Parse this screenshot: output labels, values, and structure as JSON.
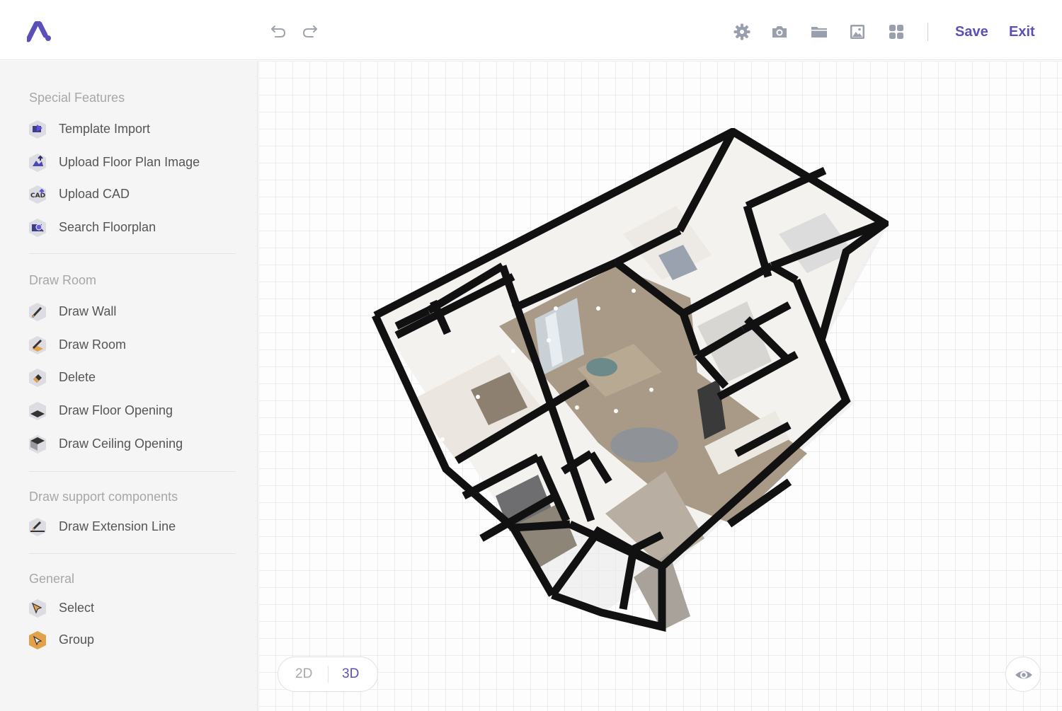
{
  "header": {
    "logo_icon": "brand-logo-icon",
    "undo_icon": "undo-icon",
    "redo_icon": "redo-icon",
    "tools": [
      "gear-icon",
      "camera-icon",
      "folder-icon",
      "image-icon",
      "grid-icon"
    ],
    "save_label": "Save",
    "exit_label": "Exit",
    "accent_color": "#5b50b8"
  },
  "sidebar": {
    "sections": [
      {
        "title": "Special Features",
        "items": [
          {
            "label": "Template Import",
            "icon": "template-import-icon"
          },
          {
            "label": "Upload Floor Plan Image",
            "icon": "upload-image-icon"
          },
          {
            "label": "Upload CAD",
            "icon": "cad-icon"
          },
          {
            "label": "Search Floorplan",
            "icon": "search-floorplan-icon"
          }
        ]
      },
      {
        "title": "Draw Room",
        "items": [
          {
            "label": "Draw Wall",
            "icon": "draw-wall-icon"
          },
          {
            "label": "Draw Room",
            "icon": "draw-room-icon"
          },
          {
            "label": "Delete",
            "icon": "delete-icon"
          },
          {
            "label": "Draw Floor Opening",
            "icon": "floor-opening-icon"
          },
          {
            "label": "Draw Ceiling Opening",
            "icon": "ceiling-opening-icon"
          }
        ]
      },
      {
        "title": "Draw support components",
        "items": [
          {
            "label": "Draw Extension Line",
            "icon": "extension-line-icon"
          }
        ]
      },
      {
        "title": "General",
        "items": [
          {
            "label": "Select",
            "icon": "select-icon"
          },
          {
            "label": "Group",
            "icon": "group-icon"
          }
        ]
      }
    ]
  },
  "view_mode": {
    "options": [
      "2D",
      "3D"
    ],
    "selected": "3D"
  },
  "eye_icon": "eye-icon"
}
